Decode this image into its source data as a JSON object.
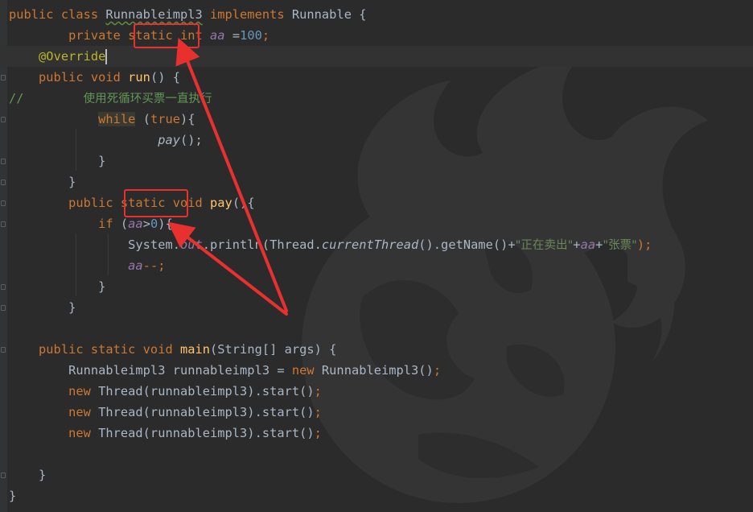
{
  "editor": {
    "colors": {
      "background": "#2b2b2b",
      "keyword": "#cc7832",
      "method": "#ffc66d",
      "number": "#6897bb",
      "string": "#6a8759",
      "field": "#9876aa",
      "comment": "#629755",
      "annotation": "#bbb529",
      "plain": "#a9b7c6",
      "markup": "#e8312f"
    },
    "code": {
      "l1": {
        "t1": "public class ",
        "t2": "Runnableimpl3",
        "t3": " implements ",
        "t4": "Runnable {"
      },
      "l2": {
        "t1": "        private ",
        "t2": "static",
        "t3": " int ",
        "t4": "aa",
        "t5": " =",
        "t6": "100",
        "t7": ";"
      },
      "l3": {
        "t1": "    ",
        "t2": "@Override"
      },
      "l4": {
        "t1": "    public void ",
        "t2": "run",
        "t3": "() {"
      },
      "l5": {
        "t1": "//",
        "t2": "        ",
        "t3": "使用死循环买票一直执行"
      },
      "l6": {
        "t1": "            ",
        "t2": "while",
        "t3": " (",
        "t4": "true",
        "t5": "){"
      },
      "l7": {
        "t1": "                    ",
        "t2": "pay",
        "t3": "();"
      },
      "l8": {
        "t1": "            }"
      },
      "l9": {
        "t1": "        }"
      },
      "l10": {
        "t1": "        public ",
        "t2": "static",
        "t3": " void ",
        "t4": "pay",
        "t5": "(){"
      },
      "l11": {
        "t1": "            if ",
        "t2": "(",
        "t3": "aa",
        "t4": ">",
        "t5": "0",
        "t6": "){"
      },
      "l12": {
        "t1": "                System.",
        "t2": "out",
        "t3": ".println(Thread.",
        "t4": "currentThread",
        "t5": "().getName()+",
        "t6": "\"正在卖出\"",
        "t7": "+",
        "t8": "aa",
        "t9": "+",
        "t10": "\"张票\"",
        "t11": ");"
      },
      "l13": {
        "t1": "                ",
        "t2": "aa",
        "t3": "--;"
      },
      "l14": {
        "t1": "            }"
      },
      "l15": {
        "t1": "        }"
      },
      "l17": {
        "t1": "    public static void ",
        "t2": "main",
        "t3": "(String[] args) {"
      },
      "l18": {
        "t1": "        Runnableimpl3 runnableimpl3 = ",
        "t2": "new",
        "t3": " Runnableimpl3()",
        "t4": ";"
      },
      "l19": {
        "t1": "        ",
        "t2": "new",
        "t3": " Thread(runnableimpl3).start()",
        "t4": ";"
      },
      "l20": {
        "t1": "        ",
        "t2": "new",
        "t3": " Thread(runnableimpl3).start()",
        "t4": ";"
      },
      "l21": {
        "t1": "        ",
        "t2": "new",
        "t3": " Thread(runnableimpl3).start()",
        "t4": ";"
      },
      "l23": {
        "t1": "    }"
      },
      "l24": {
        "t1": "}"
      }
    }
  }
}
